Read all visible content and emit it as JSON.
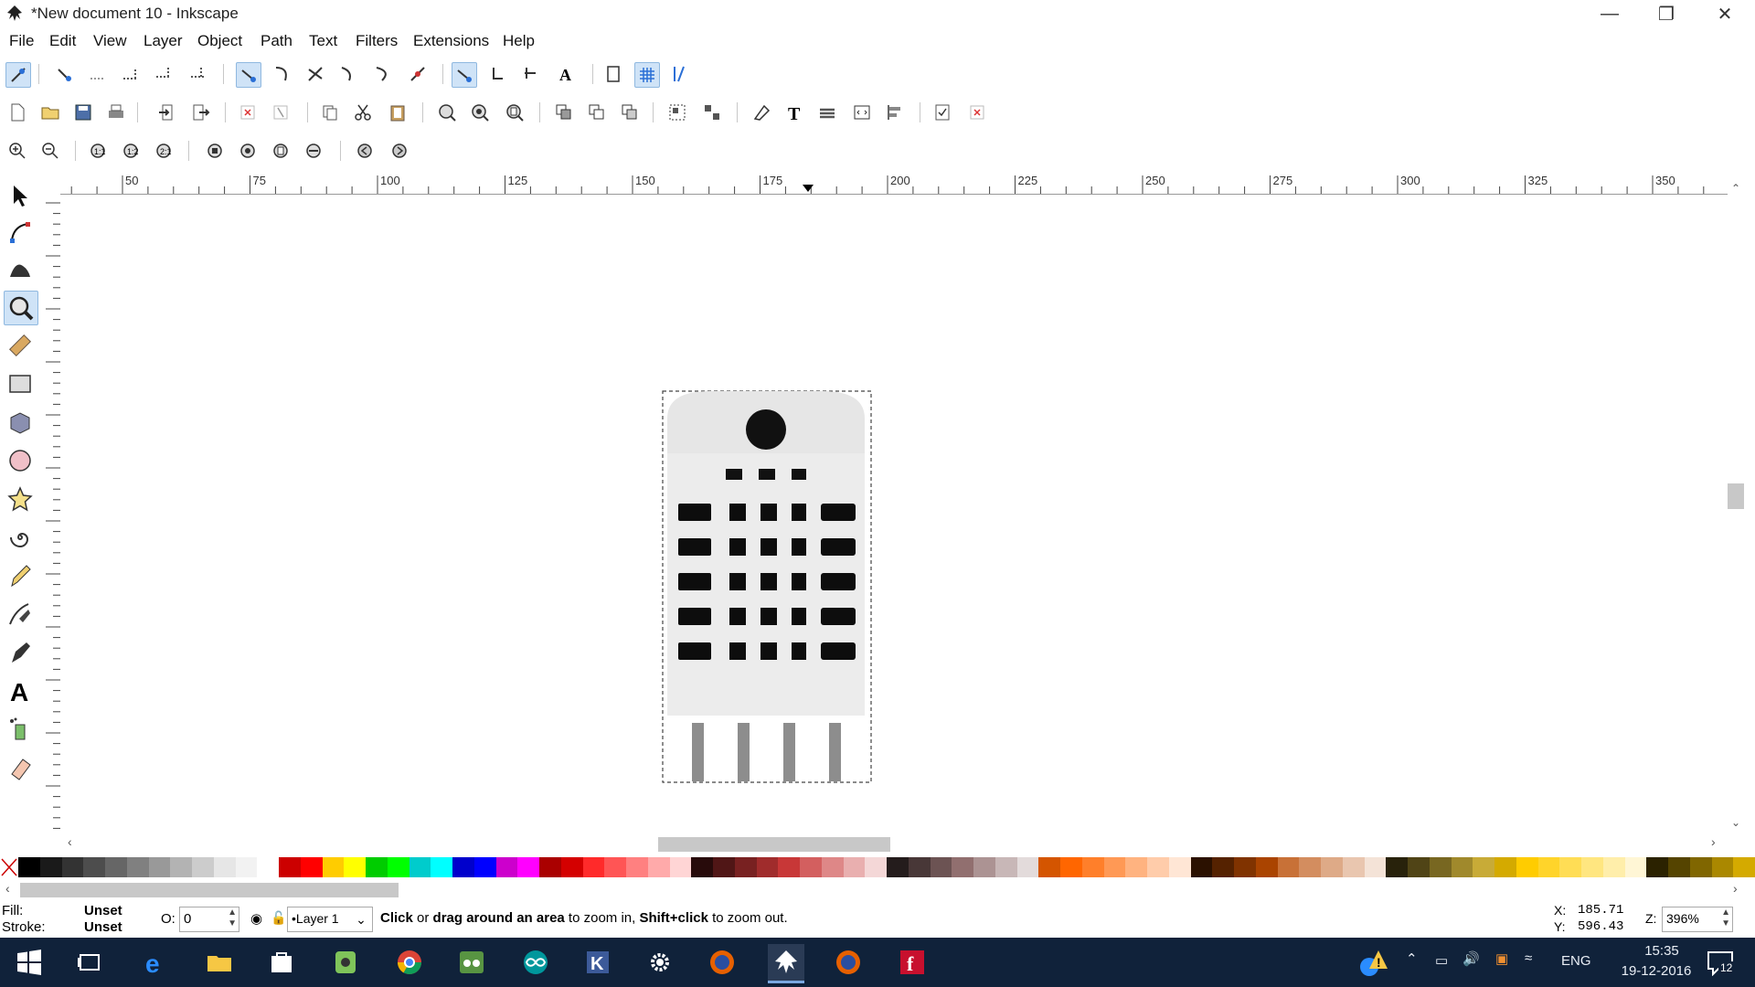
{
  "window": {
    "title": "*New document 10 - Inkscape"
  },
  "menu": [
    "File",
    "Edit",
    "View",
    "Layer",
    "Object",
    "Path",
    "Text",
    "Filters",
    "Extensions",
    "Help"
  ],
  "ruler": {
    "labels": [
      "50",
      "75",
      "100",
      "125",
      "150",
      "175",
      "200",
      "225",
      "250",
      "275",
      "300",
      "325",
      "350"
    ]
  },
  "palette": [
    "#000000",
    "#1a1a1a",
    "#333333",
    "#4d4d4d",
    "#666666",
    "#808080",
    "#999999",
    "#b3b3b3",
    "#cccccc",
    "#e6e6e6",
    "#f2f2f2",
    "#ffffff",
    "#cc0000",
    "#ff0000",
    "#ffcc00",
    "#ffff00",
    "#00cc00",
    "#00ff00",
    "#00cccc",
    "#00ffff",
    "#0000cc",
    "#0000ff",
    "#cc00cc",
    "#ff00ff",
    "#aa0000",
    "#d40000",
    "#ff2a2a",
    "#ff5555",
    "#ff8080",
    "#ffaaaa",
    "#ffd5d5",
    "#280b0b",
    "#501616",
    "#782121",
    "#a02c2c",
    "#c83737",
    "#d35f5f",
    "#de8787",
    "#e9afaf",
    "#f4d7d7",
    "#241c1c",
    "#483737",
    "#6c5353",
    "#916f6f",
    "#ac9393",
    "#c8b7b7",
    "#e3dbdb",
    "#d45500",
    "#ff6600",
    "#ff7f2a",
    "#ff9955",
    "#ffb380",
    "#ffccaa",
    "#ffe6d5",
    "#2b1100",
    "#552200",
    "#803300",
    "#aa4400",
    "#c87137",
    "#d38d5f",
    "#deaa87",
    "#e9c6af",
    "#f4e3d7",
    "#28220b",
    "#504416",
    "#786721",
    "#a0892c",
    "#c8ab37",
    "#d4aa00",
    "#ffcc00",
    "#ffd42a",
    "#ffdd55",
    "#ffe680",
    "#ffeeaa",
    "#fff6d5",
    "#2b2200",
    "#554400",
    "#806600",
    "#aa8800",
    "#d4aa00"
  ],
  "status": {
    "fill_label": "Fill:",
    "fill_value": "Unset",
    "stroke_label": "Stroke:",
    "stroke_value": "Unset",
    "opacity_label": "O:",
    "opacity_value": "0",
    "layer": "•Layer 1",
    "hint_bold1": "Click",
    "hint_text1": " or ",
    "hint_bold2": "drag around an area",
    "hint_text2": " to zoom in, ",
    "hint_bold3": "Shift+click",
    "hint_text3": " to zoom out.",
    "x_label": "X:",
    "x_value": "185.71",
    "y_label": "Y:",
    "y_value": "596.43",
    "zoom_label": "Z:",
    "zoom_value": "396%"
  },
  "taskbar": {
    "lang": "ENG",
    "time": "15:35",
    "date": "19-12-2016",
    "notifications": "12"
  }
}
